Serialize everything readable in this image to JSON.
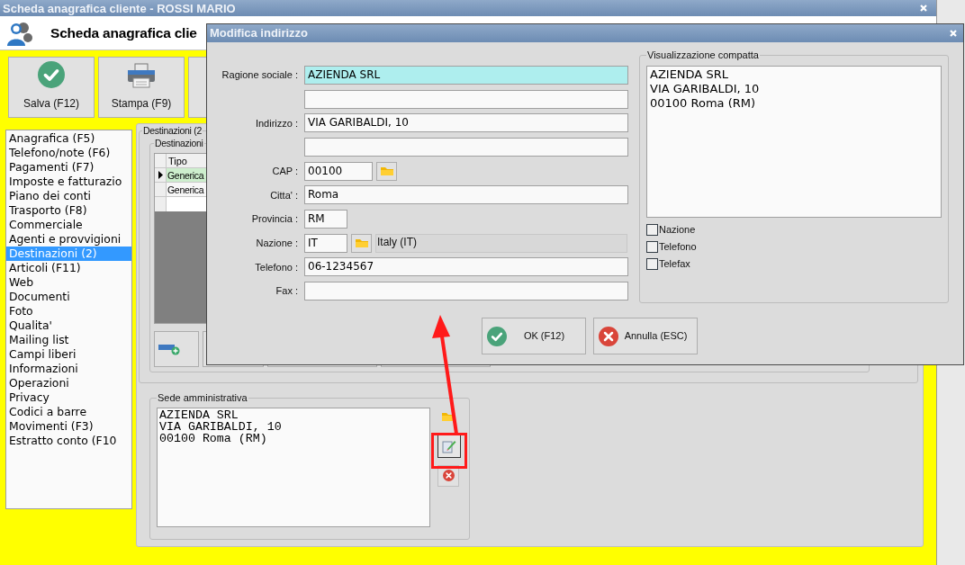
{
  "window": {
    "title": "Scheda anagrafica cliente - ROSSI MARIO"
  },
  "header": {
    "title": "Scheda anagrafica clie"
  },
  "toolbar": [
    {
      "kind": "save",
      "label": "Salva (F12)"
    },
    {
      "kind": "print",
      "label": "Stampa (F9)"
    },
    {
      "kind": "blank"
    }
  ],
  "sidebar": {
    "items": [
      {
        "label": "Anagrafica (F5)",
        "selected": false
      },
      {
        "label": "Telefono/note (F6)",
        "selected": false
      },
      {
        "label": "Pagamenti (F7)",
        "selected": false
      },
      {
        "label": "Imposte e fatturazio",
        "selected": false
      },
      {
        "label": "Piano dei conti",
        "selected": false
      },
      {
        "label": "Trasporto (F8)",
        "selected": false
      },
      {
        "label": "Commerciale",
        "selected": false
      },
      {
        "label": "Agenti e provvigioni",
        "selected": false
      },
      {
        "label": "Destinazioni (2)",
        "selected": true
      },
      {
        "label": "Articoli (F11)",
        "selected": false
      },
      {
        "label": "Web",
        "selected": false
      },
      {
        "label": "Documenti",
        "selected": false
      },
      {
        "label": "Foto",
        "selected": false
      },
      {
        "label": "Qualita'",
        "selected": false
      },
      {
        "label": "Mailing list",
        "selected": false
      },
      {
        "label": "Campi liberi",
        "selected": false
      },
      {
        "label": "Informazioni",
        "selected": false
      },
      {
        "label": "Operazioni",
        "selected": false
      },
      {
        "label": "Privacy",
        "selected": false
      },
      {
        "label": "Codici a barre",
        "selected": false
      },
      {
        "label": "Movimenti (F3)",
        "selected": false
      },
      {
        "label": "Estratto conto (F10",
        "selected": false
      }
    ]
  },
  "destinazioni": {
    "title": "Destinazioni (2",
    "inner_title": "Destinazioni",
    "table": {
      "columns": [
        "Tipo"
      ],
      "rows": [
        {
          "cells": [
            "Generica"
          ],
          "selected": true
        },
        {
          "cells": [
            "Generica"
          ],
          "selected": false
        }
      ]
    }
  },
  "sede": {
    "title": "Sede amministrativa",
    "lines": [
      "AZIENDA SRL",
      "VIA GARIBALDI, 10",
      "00100 Roma (RM)"
    ]
  },
  "dialog": {
    "title": "Modifica indirizzo",
    "fields": [
      {
        "label": "Ragione sociale :",
        "value": "AZIENDA SRL",
        "kind": "wide",
        "focused": true
      },
      {
        "kind": "wide",
        "focused": false
      },
      {
        "label": "Indirizzo :",
        "value": "VIA GARIBALDI, 10",
        "kind": "wide",
        "focused": false
      },
      {
        "kind": "wide",
        "focused": false
      },
      {
        "label": "CAP :",
        "value": "00100",
        "kind": "zip",
        "focused": false
      },
      {
        "label": "Citta' :",
        "value": "Roma",
        "kind": "wide",
        "focused": false
      },
      {
        "label": "Provincia :",
        "value": "RM",
        "kind": "short",
        "focused": false
      },
      {
        "label": "Nazione :",
        "value": "IT",
        "kind": "country",
        "description": "Italy (IT)",
        "focused": false
      },
      {
        "label": "Telefono :",
        "value": "06-1234567",
        "kind": "wide",
        "focused": false
      },
      {
        "label": "Fax :",
        "kind": "wide",
        "focused": false
      }
    ],
    "preview": {
      "title": "Visualizzazione compatta",
      "lines": [
        "AZIENDA SRL",
        "VIA GARIBALDI, 10",
        "00100 Roma (RM)"
      ],
      "options": [
        {
          "label": "Nazione",
          "checked": false
        },
        {
          "label": "Telefono",
          "checked": false
        },
        {
          "label": "Telefax",
          "checked": false
        }
      ]
    },
    "buttons": [
      {
        "kind": "ok",
        "label": "OK (F12)"
      },
      {
        "kind": "cancel",
        "label": "Annulla (ESC)"
      }
    ]
  }
}
